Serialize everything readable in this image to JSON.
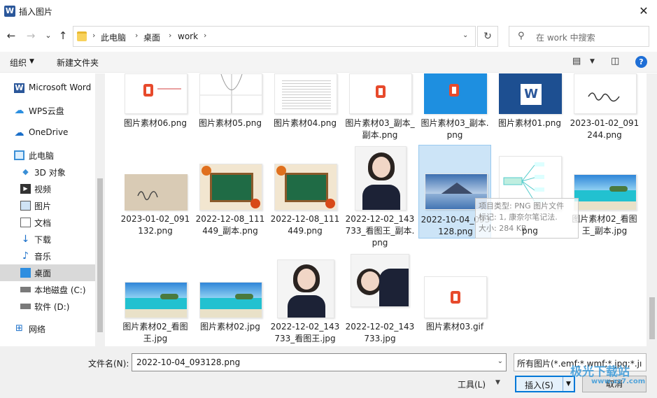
{
  "window": {
    "title": "插入图片",
    "app_icon": "W"
  },
  "nav": {
    "back_icon": "←",
    "forward_icon": "→",
    "recent_icon": "⌄",
    "up_icon": "↑",
    "breadcrumbs": [
      "此电脑",
      "桌面",
      "work"
    ],
    "refresh_icon": "↻",
    "search_placeholder": "在 work 中搜索"
  },
  "toolbar": {
    "organize": "组织",
    "new_folder": "新建文件夹"
  },
  "sidebar": {
    "items": [
      {
        "label": "Microsoft Word",
        "icon": "word-icon"
      },
      {
        "label": "WPS云盘",
        "icon": "cloud-icon"
      },
      {
        "label": "OneDrive",
        "icon": "onedrive-icon"
      },
      {
        "label": "此电脑",
        "icon": "computer-icon"
      },
      {
        "label": "3D 对象",
        "icon": "cube-icon"
      },
      {
        "label": "视频",
        "icon": "video-icon"
      },
      {
        "label": "图片",
        "icon": "picture-icon"
      },
      {
        "label": "文档",
        "icon": "document-icon"
      },
      {
        "label": "下载",
        "icon": "download-icon"
      },
      {
        "label": "音乐",
        "icon": "music-icon"
      },
      {
        "label": "桌面",
        "icon": "desktop-icon",
        "selected": true
      },
      {
        "label": "本地磁盘 (C:)",
        "icon": "drive-c-icon"
      },
      {
        "label": "软件 (D:)",
        "icon": "drive-d-icon"
      },
      {
        "label": "网络",
        "icon": "network-icon"
      }
    ]
  },
  "files": [
    {
      "name": "图片素材06.png",
      "kind": "doc-office"
    },
    {
      "name": "图片素材05.png",
      "kind": "graph"
    },
    {
      "name": "图片素材04.png",
      "kind": "text-doc"
    },
    {
      "name": "图片素材03_副本_副本.png",
      "kind": "office"
    },
    {
      "name": "图片素材03_副本.png",
      "kind": "office-blue"
    },
    {
      "name": "图片素材01.png",
      "kind": "word"
    },
    {
      "name": "2023-01-02_091244.png",
      "kind": "signature"
    },
    {
      "name": "2023-01-02_091132.png",
      "kind": "handwriting"
    },
    {
      "name": "2022-12-08_111449_副本.png",
      "kind": "chalkboard"
    },
    {
      "name": "2022-12-08_111449.png",
      "kind": "chalkboard"
    },
    {
      "name": "2022-12-02_143733_看图王_副本.png",
      "kind": "portrait"
    },
    {
      "name": "2022-10-04_093128.png",
      "kind": "mountain",
      "selected": true
    },
    {
      "name": "",
      "kind": "mindmap"
    },
    {
      "name": "图片素材02_看图王_副本.jpg",
      "kind": "beach"
    },
    {
      "name": "图片素材02_看图王.jpg",
      "kind": "beach"
    },
    {
      "name": "图片素材02.jpg",
      "kind": "beach"
    },
    {
      "name": "2022-12-02_143733_看图王.jpg",
      "kind": "portrait"
    },
    {
      "name": "2022-12-02_143733.jpg",
      "kind": "portrait-tilt"
    },
    {
      "name": "图片素材03.gif",
      "kind": "office"
    }
  ],
  "tooltip": {
    "type_line": "项目类型: PNG 图片文件",
    "tag_line": "标记: 1, 康奈尔笔记法.",
    "size_line": "大小: 284 KB",
    "tile_tail": "png"
  },
  "bottom": {
    "filename_label": "文件名(N):",
    "filename_value": "2022-10-04_093128.png",
    "filetype_value": "所有图片(*.emf;*.wmf;*.jpg;*.jı",
    "tools_label": "工具(L)",
    "insert_label": "插入(S)",
    "cancel_label": "取消"
  },
  "watermark": {
    "text": "极光下载站",
    "url": "www.xz7.com"
  },
  "colors": {
    "selection": "#cce4f7",
    "accent": "#0078d7",
    "word_blue": "#2b579a",
    "office_red": "#e74a2c"
  }
}
